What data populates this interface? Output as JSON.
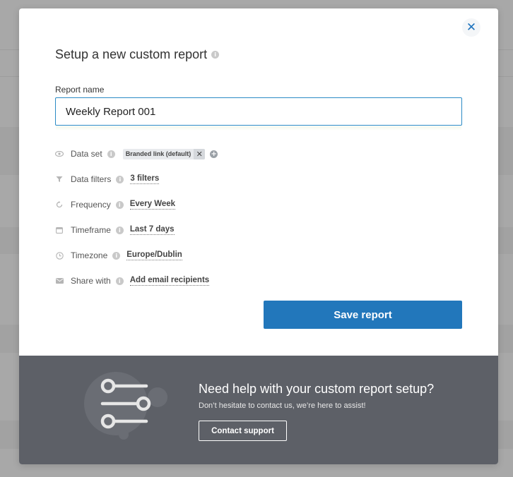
{
  "modal": {
    "title": "Setup a new custom report",
    "close_icon": "close-icon",
    "report_name_label": "Report name",
    "report_name_value": "Weekly Report 001",
    "options": [
      {
        "icon": "eye-icon",
        "label": "Data set",
        "chip": "Branded link (default)"
      },
      {
        "icon": "filter-icon",
        "label": "Data filters",
        "value": "3 filters"
      },
      {
        "icon": "refresh-icon",
        "label": "Frequency",
        "value": "Every Week"
      },
      {
        "icon": "calendar-icon",
        "label": "Timeframe",
        "value": "Last 7 days"
      },
      {
        "icon": "clock-icon",
        "label": "Timezone",
        "value": "Europe/Dublin"
      },
      {
        "icon": "mail-icon",
        "label": "Share with",
        "value": "Add email recipients"
      }
    ],
    "save_label": "Save report"
  },
  "footer": {
    "title": "Need help with your custom report setup?",
    "subtitle": "Don’t hesitate to contact us, we’re here to assist!",
    "contact_label": "Contact support"
  },
  "colors": {
    "accent": "#2277bb",
    "footer_bg": "#5d6067",
    "overlay": "#a8a8a8"
  }
}
